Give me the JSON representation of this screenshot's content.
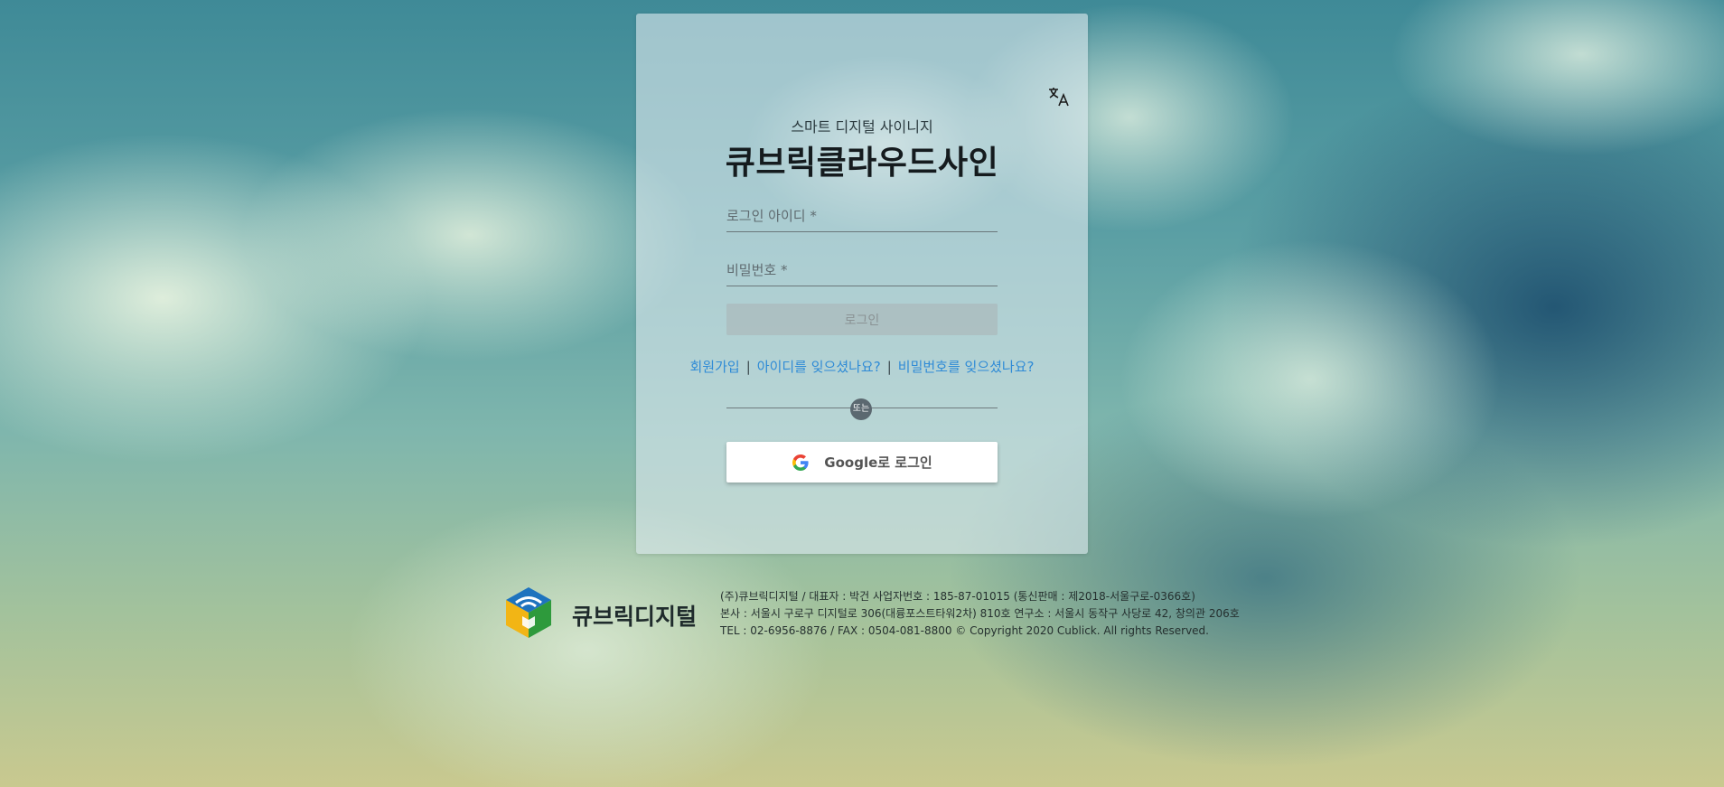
{
  "login": {
    "subtitle": "스마트 디지털 사이니지",
    "title": "큐브릭클라우드사인",
    "id_placeholder": "로그인 아이디 *",
    "pw_placeholder": "비밀번호 *",
    "login_label": "로그인",
    "links": {
      "signup": "회원가입",
      "separator": "|",
      "forgot_id": "아이디를 잊으셨나요?",
      "forgot_pw": "비밀번호를 잊으셨나요?"
    },
    "or_label": "또는",
    "google_label": "Google로 로그인",
    "language_icon": "translate-icon"
  },
  "footer": {
    "company": "큐브릭디지털",
    "line1": "(주)큐브릭디지털 / 대표자 : 박건 사업자번호 : 185-87-01015 (통신판매 : 제2018-서울구로-0366호)",
    "line2": "본사 : 서울시 구로구 디지털로 306(대륭포스트타워2차) 810호 연구소 : 서울시 동작구 사당로 42, 창의관 206호",
    "line3": "TEL : 02-6956-8876 / FAX : 0504-081-8800 © Copyright 2020 Cublick. All rights Reserved."
  },
  "colors": {
    "link": "#2f8bd6",
    "logo_blue": "#1e73be",
    "logo_yellow": "#f2b515",
    "logo_green": "#2e9a3c"
  }
}
